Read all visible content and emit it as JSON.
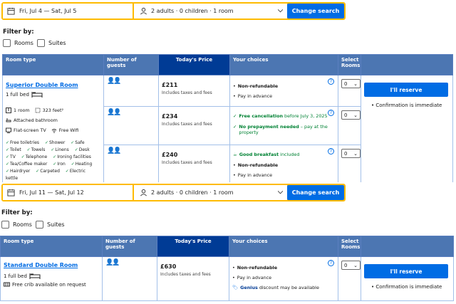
{
  "panels": [
    {
      "search": {
        "dates": "Fri, Jul 4 — Sat, Jul 5",
        "guests": "2 adults · 0 children · 1 room",
        "button": "Change search"
      },
      "filter": {
        "title": "Filter by:",
        "options": [
          "Rooms",
          "Suites"
        ]
      },
      "headers": {
        "room_type": "Room type",
        "guests": "Number of guests",
        "price": "Today's Price",
        "choices": "Your choices",
        "select": "Select Rooms"
      },
      "room": {
        "name": "Superior Double Room",
        "bed": "1 full bed",
        "size_rooms": "1 room",
        "size_area": "323 feet²",
        "bathroom": "Attached bathroom",
        "tv": "Flat-screen TV",
        "wifi": "Free Wifi",
        "amenities": [
          "Free toiletries",
          "Shower",
          "Safe",
          "Toilet",
          "Towels",
          "Linens",
          "Desk",
          "TV",
          "Telephone",
          "Ironing facilities",
          "Tea/Coffee maker",
          "Iron",
          "Heating",
          "Hairdryer",
          "Carpeted",
          "Electric kettle"
        ]
      },
      "rows": [
        {
          "price": "£211",
          "price_note": "Includes taxes and fees",
          "choices": [
            {
              "text": "Non-refundable",
              "bold": true
            },
            {
              "text": "Pay in advance"
            }
          ],
          "select": "0"
        },
        {
          "price": "£234",
          "price_note": "Includes taxes and fees",
          "choices": [
            {
              "bold_text": "Free cancellation",
              "text": " before July 3, 2025",
              "green": true
            },
            {
              "bold_text": "No prepayment needed",
              "text": " – pay at the property",
              "green": true
            }
          ],
          "select": "0"
        },
        {
          "price": "£240",
          "price_note": "Includes taxes and fees",
          "choices": [
            {
              "bold_text": "Good breakfast",
              "text": " included",
              "green": true
            },
            {
              "text": "Non-refundable",
              "bold": true
            },
            {
              "text": "Pay in advance"
            }
          ],
          "select": "0"
        }
      ],
      "reserve": {
        "button": "I'll reserve",
        "note": "Confirmation is immediate"
      }
    },
    {
      "search": {
        "dates": "Fri, Jul 11 — Sat, Jul 12",
        "guests": "2 adults · 0 children · 1 room",
        "button": "Change search"
      },
      "filter": {
        "title": "Filter by:",
        "options": [
          "Rooms",
          "Suites"
        ]
      },
      "headers": {
        "room_type": "Room type",
        "guests": "Number of guests",
        "price": "Today's Price",
        "choices": "Your choices",
        "select": "Select Rooms"
      },
      "room": {
        "name": "Standard Double Room",
        "bed": "1 full bed",
        "crib": "Free crib available on request"
      },
      "rows": [
        {
          "price": "£630",
          "price_note": "Includes taxes and fees",
          "choices": [
            {
              "text": "Non-refundable",
              "bold": true
            },
            {
              "text": "Pay in advance"
            },
            {
              "bold_text": "Genius",
              "text": " discount may be available",
              "genius": true
            }
          ],
          "select": "0"
        }
      ],
      "reserve": {
        "button": "I'll reserve",
        "note": "Confirmation is immediate"
      }
    }
  ],
  "colors": {
    "accent": "#006ce4",
    "header": "#4c76b2",
    "price_header": "#003b95",
    "search_border": "#febb02",
    "green": "#008234"
  }
}
